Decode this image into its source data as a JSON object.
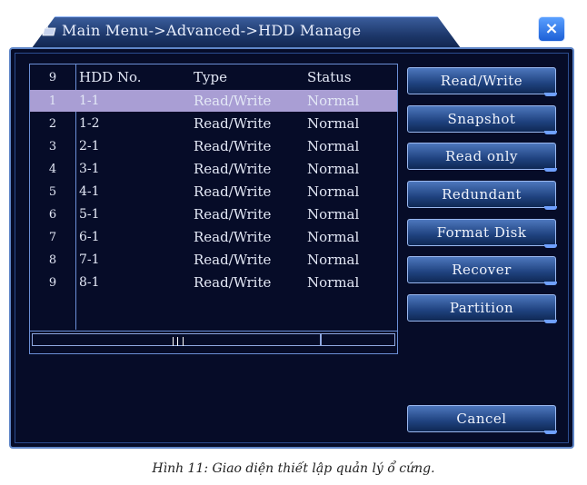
{
  "window": {
    "title": "Main Menu->Advanced->HDD Manage",
    "close_label": "×"
  },
  "table": {
    "headers": [
      "9",
      "HDD No.",
      "Type",
      "Status"
    ],
    "rows": [
      {
        "num": "1",
        "hdd": "1-1",
        "type": "Read/Write",
        "status": "Normal",
        "selected": true
      },
      {
        "num": "2",
        "hdd": "1-2",
        "type": "Read/Write",
        "status": "Normal"
      },
      {
        "num": "3",
        "hdd": "2-1",
        "type": "Read/Write",
        "status": "Normal"
      },
      {
        "num": "4",
        "hdd": "3-1",
        "type": "Read/Write",
        "status": "Normal"
      },
      {
        "num": "5",
        "hdd": "4-1",
        "type": "Read/Write",
        "status": "Normal"
      },
      {
        "num": "6",
        "hdd": "5-1",
        "type": "Read/Write",
        "status": "Normal"
      },
      {
        "num": "7",
        "hdd": "6-1",
        "type": "Read/Write",
        "status": "Normal"
      },
      {
        "num": "8",
        "hdd": "7-1",
        "type": "Read/Write",
        "status": "Normal"
      },
      {
        "num": "9",
        "hdd": "8-1",
        "type": "Read/Write",
        "status": "Normal"
      }
    ]
  },
  "buttons": {
    "read_write": "Read/Write",
    "snapshot": "Snapshot",
    "read_only": "Read only",
    "redundant": "Redundant",
    "format_disk": "Format Disk",
    "recover": "Recover",
    "partition": "Partition",
    "cancel": "Cancel"
  },
  "caption": "Hình 11: Giao diện thiết lập quản lý ổ cứng.",
  "colors": {
    "background": "#060c28",
    "border": "#6b8fd6",
    "selected_row": "#a99ed4",
    "button": "#1f427f",
    "close_button": "#1c5fd6"
  }
}
